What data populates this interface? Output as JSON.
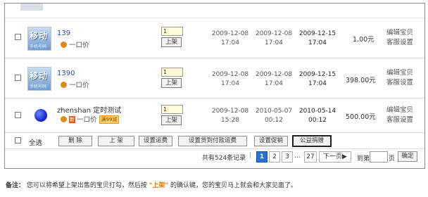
{
  "products": [
    {
      "thumb_text": "移动",
      "thumb_sub": "手机号码",
      "name": "139",
      "sale_type": "一口价",
      "qty": "1",
      "list_btn": "上架",
      "date1_line1": "2009-12-08",
      "date1_line2": "17:04",
      "date2_line1": "2009-12-08",
      "date2_line2": "17:04",
      "date3_line1": "2009-12-15",
      "date3_line2": "17:04",
      "price": "1.00元",
      "op1": "编辑宝贝",
      "op2": "客服设置"
    },
    {
      "thumb_text": "移动",
      "thumb_sub": "手机号码",
      "name": "1390",
      "sale_type": "一口价",
      "qty": "1",
      "list_btn": "上架",
      "date1_line1": "2009-12-08",
      "date1_line2": "17:04",
      "date2_line1": "2009-12-08",
      "date2_line2": "17:04",
      "date3_line1": "2009-12-15",
      "date3_line2": "17:04",
      "price": "398.00元",
      "op1": "编辑宝贝",
      "op2": "客服设置"
    },
    {
      "name": "zhenshan 定时测试",
      "new_badge": "新",
      "sale_type": "一口价",
      "promo": "满99减",
      "qty": "1",
      "list_btn": "上架",
      "date1_line1": "2009-12-08",
      "date1_line2": "15:28",
      "date2_line1": "2010-05-07",
      "date2_line2": "00:12",
      "date3_line1": "2010-05-14",
      "date3_line2": "00:12",
      "price": "500.00元",
      "op1": "编辑宝贝",
      "op2": "客服设置"
    }
  ],
  "actions": {
    "select_all": "全选",
    "delete": "删 除",
    "list": "上 架",
    "set_shipping": "设置运费",
    "set_cod_shipping": "设置货到付款运费",
    "set_promo": "设置促销",
    "charity": "公益捐赠"
  },
  "pager": {
    "total": "共有524条记录",
    "sep": "|",
    "p1": "1",
    "p2": "2",
    "p3": "3",
    "ellipsis": "...",
    "last": "27",
    "next": "下一页▶",
    "goto": "到第",
    "page_unit": "页",
    "go_value": "",
    "confirm": "确定"
  },
  "note": {
    "label": "备注：",
    "text1": "您可以将希望上架出售的宝贝打勾，然后按",
    "highlight": "\"上架\"",
    "text2": "的确认键，您的宝贝马上就会和大家见面了。"
  }
}
